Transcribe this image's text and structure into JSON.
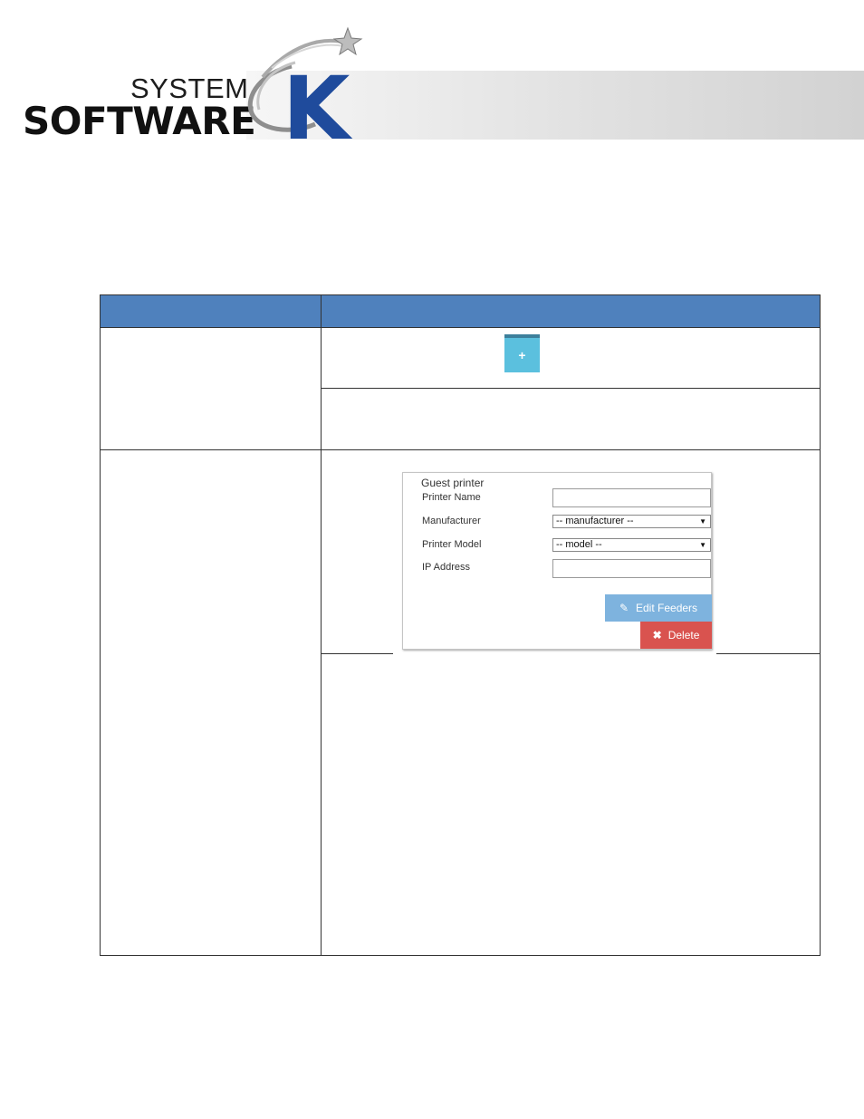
{
  "header": {
    "logo_system": "SYSTEM",
    "logo_software": "SOFTWARE",
    "logo_k": "K"
  },
  "add_button": {
    "label": "+"
  },
  "guest_printer": {
    "legend": "Guest printer",
    "fields": {
      "printer_name": {
        "label": "Printer Name",
        "value": ""
      },
      "manufacturer": {
        "label": "Manufacturer",
        "selected": "-- manufacturer --"
      },
      "printer_model": {
        "label": "Printer Model",
        "selected": "-- model --"
      },
      "ip_address": {
        "label": "IP Address",
        "value": ""
      }
    },
    "edit_feeders_label": "Edit Feeders",
    "delete_label": "Delete"
  },
  "colors": {
    "table_header": "#4f81bd",
    "add_button": "#5bc0de",
    "edit_button": "#7eb3de",
    "delete_button": "#d9534f",
    "logo_blue": "#1f4b9c"
  },
  "icons": {
    "edit": "pencil-icon",
    "delete": "close-icon",
    "dropdown": "caret-down-icon"
  }
}
